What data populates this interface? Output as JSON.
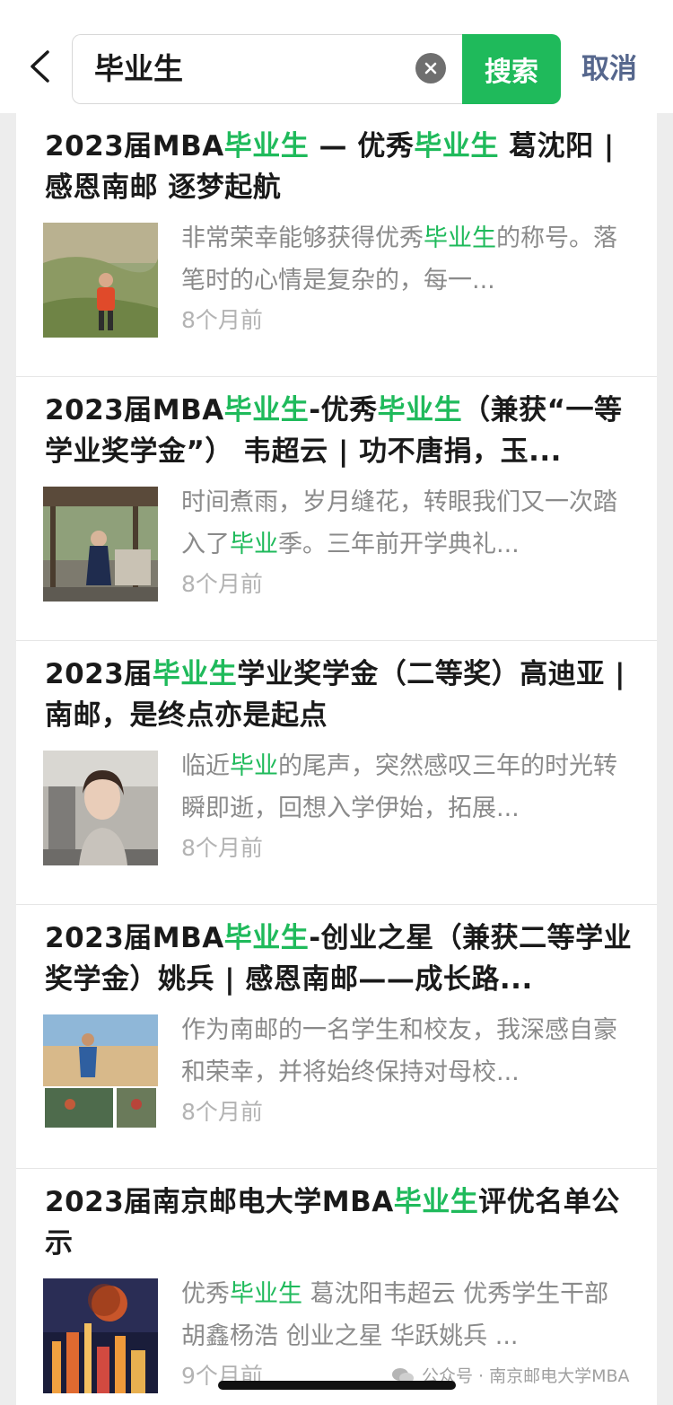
{
  "search": {
    "query": "毕业生",
    "search_label": "搜索",
    "cancel_label": "取消"
  },
  "results": [
    {
      "title": [
        "2023届MBA",
        "毕业生",
        " — 优秀",
        "毕业生",
        " 葛沈阳 | 感恩南邮 逐梦起航"
      ],
      "snippet": [
        "非常荣幸能够获得优秀",
        "毕业生",
        "的称号。落笔时的心情是复杂的，每一..."
      ],
      "time": "8个月前"
    },
    {
      "title": [
        "2023届MBA",
        "毕业生",
        "-优秀",
        "毕业生",
        "（兼获“一等学业奖学金”） 韦超云 | 功不唐捐，玉..."
      ],
      "snippet": [
        "时间煮雨，岁月缝花，转眼我们又一次踏入了",
        "毕业",
        "季。三年前开学典礼..."
      ],
      "time": "8个月前"
    },
    {
      "title": [
        "2023届",
        "毕业生",
        "学业奖学金（二等奖）高迪亚 | 南邮，是终点亦是起点"
      ],
      "snippet": [
        "临近",
        "毕业",
        "的尾声，突然感叹三年的时光转瞬即逝，回想入学伊始，拓展..."
      ],
      "time": "8个月前"
    },
    {
      "title": [
        "2023届MBA",
        "毕业生",
        "-创业之星（兼获二等学业奖学金）姚兵 | 感恩南邮——成长路..."
      ],
      "snippet": [
        "作为南邮的一名学生和校友，我深感自豪和荣幸，并将始终保持对母校..."
      ],
      "time": "8个月前"
    },
    {
      "title": [
        "2023届南京邮电大学MBA",
        "毕业生",
        "评优名单公示"
      ],
      "snippet": [
        "优秀",
        "毕业生",
        " 葛沈阳韦超云 优秀学生干部 胡鑫杨浩 创业之星 华跃姚兵 ..."
      ],
      "time": "9个月前"
    }
  ],
  "watermark": "公众号 · 南京邮电大学MBA",
  "colors": {
    "accent": "#1fba5b",
    "cancel": "#56678d",
    "time": "#b3b3b3",
    "snippet": "#8a8a8a"
  }
}
